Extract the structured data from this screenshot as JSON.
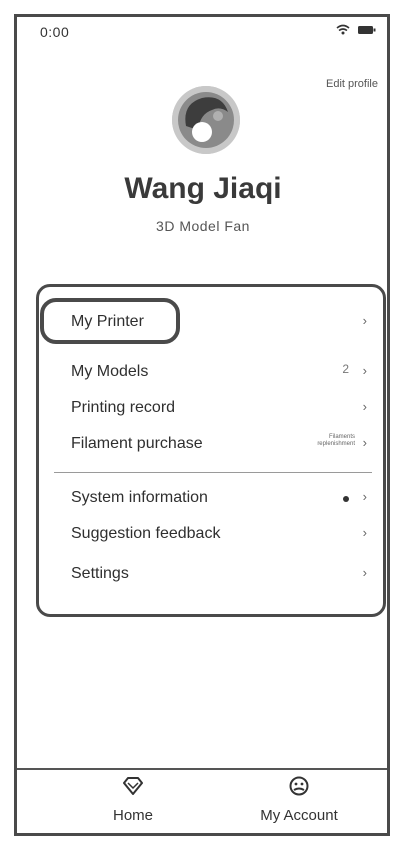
{
  "status": {
    "time": "0:00"
  },
  "profile": {
    "edit_label": "Edit profile",
    "name": "Wang Jiaqi",
    "tag": "3D Model Fan"
  },
  "menu": {
    "items": [
      {
        "label": "My Printer"
      },
      {
        "label": "My Models",
        "badge": "2"
      },
      {
        "label": "Printing record"
      },
      {
        "label": "Filament purchase",
        "note": "Filaments replenishment"
      },
      {
        "label": "System information"
      },
      {
        "label": "Suggestion feedback"
      },
      {
        "label": "Settings"
      }
    ],
    "chevron": "›"
  },
  "tabbar": {
    "tabs": [
      {
        "label": "Home",
        "icon": "diamond-icon"
      },
      {
        "label": "My Account",
        "icon": "user-face-icon"
      }
    ]
  }
}
